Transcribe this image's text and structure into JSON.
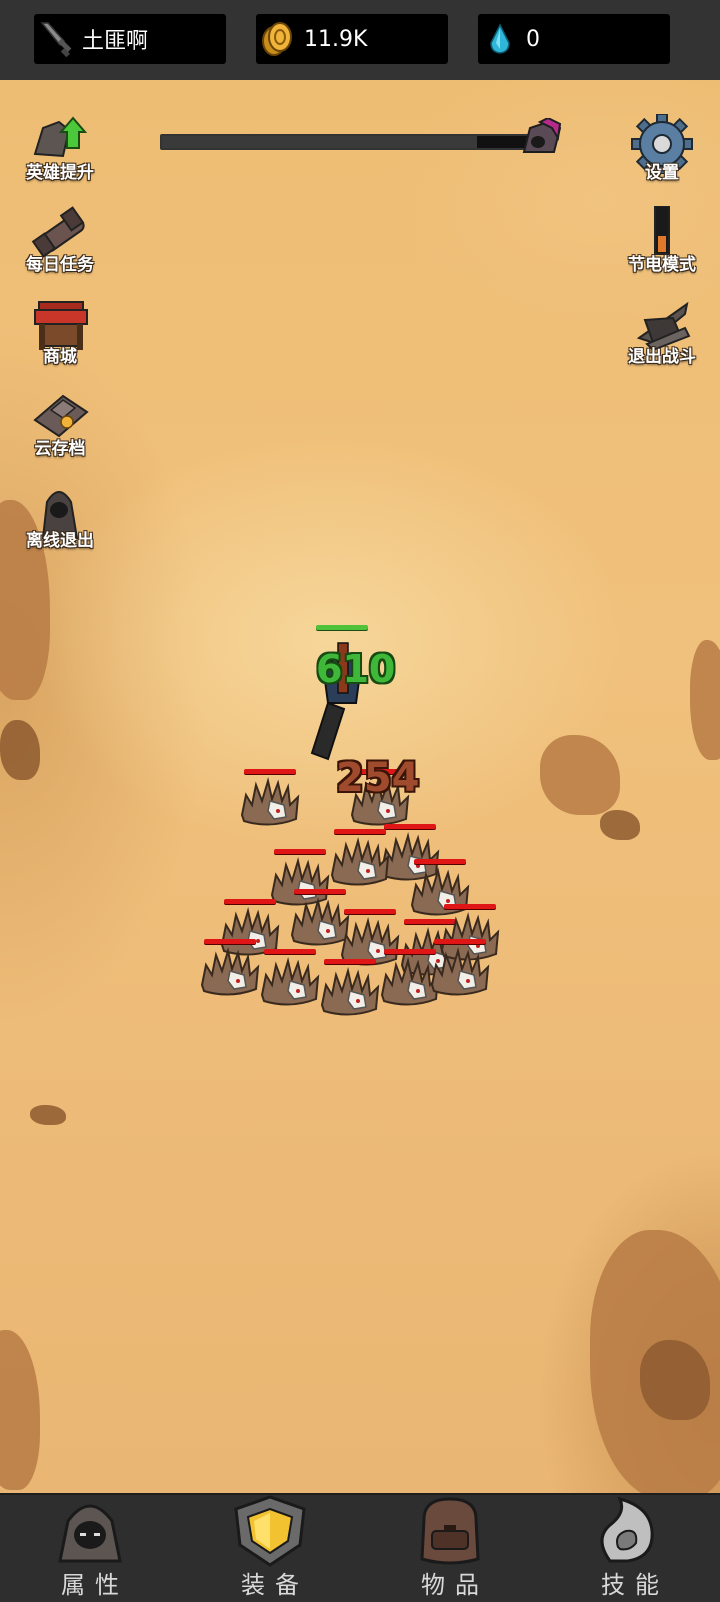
{
  "resources": {
    "player_name": "土匪啊",
    "gold": "11.9K",
    "gems": "0"
  },
  "wave_progress": 0.85,
  "left_menu": [
    {
      "label": "英雄提升",
      "icon": "hero-upgrade-icon"
    },
    {
      "label": "每日任务",
      "icon": "daily-quest-icon"
    },
    {
      "label": "商城",
      "icon": "shop-stall-icon"
    },
    {
      "label": "云存档",
      "icon": "cloud-save-icon"
    },
    {
      "label": "离线退出",
      "icon": "offline-exit-icon"
    }
  ],
  "right_menu": [
    {
      "label": "设置",
      "icon": "gear-icon"
    },
    {
      "label": "节电模式",
      "icon": "power-save-icon"
    },
    {
      "label": "退出战斗",
      "icon": "exit-battle-icon"
    }
  ],
  "battle": {
    "hero_damage_text": "610",
    "enemy_damage_text": "254"
  },
  "bottom_nav": [
    {
      "label": "属性",
      "icon": "hooded-hero-icon"
    },
    {
      "label": "装备",
      "icon": "shield-icon"
    },
    {
      "label": "物品",
      "icon": "backpack-icon"
    },
    {
      "label": "技能",
      "icon": "skill-swirl-icon"
    }
  ],
  "colors": {
    "top_bar": "#333333",
    "sand": "#f0c17c",
    "enemy_hp": "#e01515",
    "hero_hp": "#4fc23a",
    "nav_bg": "#2e2e2e"
  }
}
